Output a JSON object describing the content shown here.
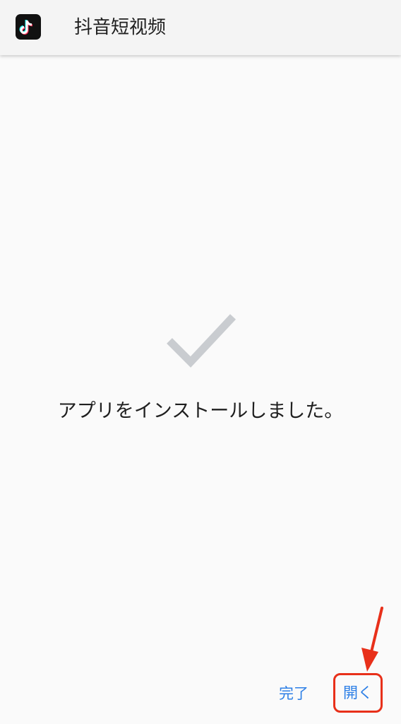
{
  "app_bar": {
    "icon": "tiktok-logo-icon",
    "title": "抖音短视频"
  },
  "status": {
    "icon": "checkmark-icon",
    "message": "アプリをインストールしました。"
  },
  "actions": {
    "done_label": "完了",
    "open_label": "開く"
  },
  "annotation": {
    "arrow_icon": "red-arrow-icon",
    "highlight_color": "#e8301a"
  },
  "colors": {
    "accent": "#2d7fe6",
    "checkmark": "#c9ccd0",
    "background": "#fafafa",
    "app_bar": "#f4f4f4"
  }
}
